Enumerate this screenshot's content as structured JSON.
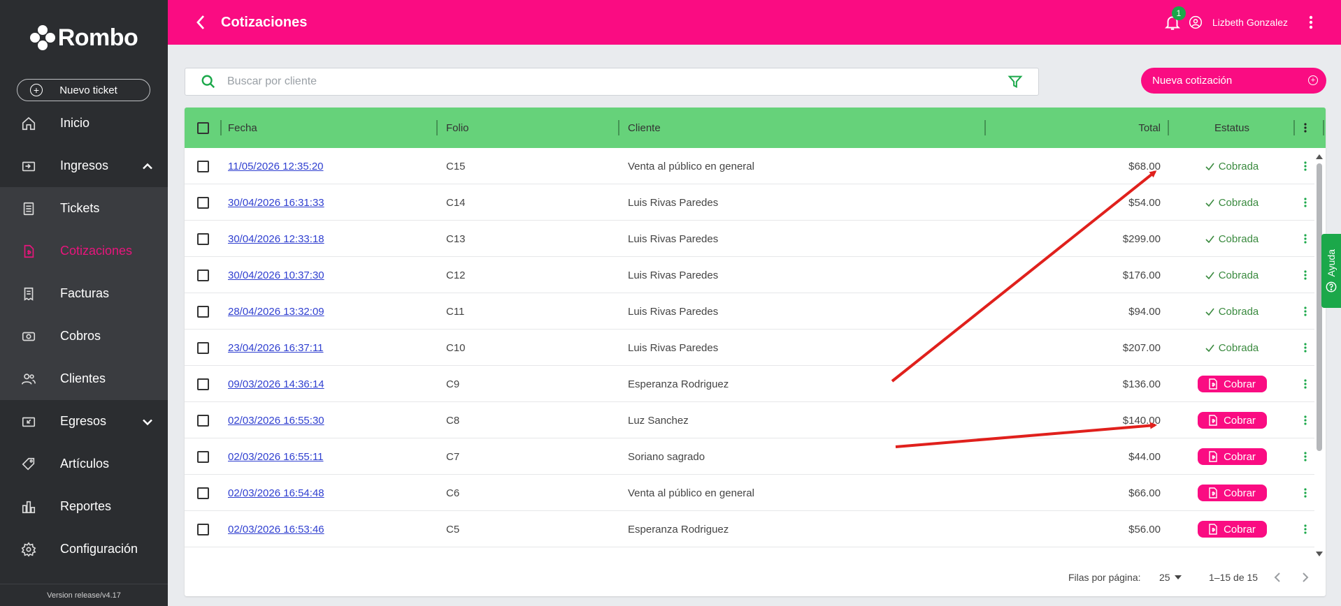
{
  "sidebar": {
    "logo_text": "Rombo",
    "new_ticket_label": "Nuevo ticket",
    "items": [
      {
        "label": "Inicio",
        "icon": "home-icon"
      },
      {
        "label": "Ingresos",
        "icon": "income-icon"
      },
      {
        "label": "Tickets",
        "icon": "receipt-icon"
      },
      {
        "label": "Cotizaciones",
        "icon": "quote-icon"
      },
      {
        "label": "Facturas",
        "icon": "invoice-icon"
      },
      {
        "label": "Cobros",
        "icon": "cash-icon"
      },
      {
        "label": "Clientes",
        "icon": "users-icon"
      },
      {
        "label": "Egresos",
        "icon": "expense-icon"
      },
      {
        "label": "Artículos",
        "icon": "tag-icon"
      },
      {
        "label": "Reportes",
        "icon": "chart-icon"
      },
      {
        "label": "Configuración",
        "icon": "gear-icon"
      }
    ],
    "version": "Version release/v4.17"
  },
  "topbar": {
    "title": "Cotizaciones",
    "notification_count": "1",
    "user_name": "Lizbeth Gonzalez"
  },
  "search": {
    "placeholder": "Buscar por cliente"
  },
  "actions": {
    "new_quote_label": "Nueva cotización"
  },
  "table": {
    "headers": {
      "fecha": "Fecha",
      "folio": "Folio",
      "cliente": "Cliente",
      "total": "Total",
      "estatus": "Estatus"
    },
    "rows": [
      {
        "fecha": "11/05/2026  12:35:20",
        "folio": "C15",
        "cliente": "Venta al público en general",
        "total": "$68.00",
        "estatus": "Cobrada"
      },
      {
        "fecha": "30/04/2026  16:31:33",
        "folio": "C14",
        "cliente": "Luis Rivas Paredes",
        "total": "$54.00",
        "estatus": "Cobrada"
      },
      {
        "fecha": "30/04/2026  12:33:18",
        "folio": "C13",
        "cliente": "Luis Rivas Paredes",
        "total": "$299.00",
        "estatus": "Cobrada"
      },
      {
        "fecha": "30/04/2026  10:37:30",
        "folio": "C12",
        "cliente": "Luis Rivas Paredes",
        "total": "$176.00",
        "estatus": "Cobrada"
      },
      {
        "fecha": "28/04/2026  13:32:09",
        "folio": "C11",
        "cliente": "Luis Rivas Paredes",
        "total": "$94.00",
        "estatus": "Cobrada"
      },
      {
        "fecha": "23/04/2026  16:37:11",
        "folio": "C10",
        "cliente": "Luis Rivas Paredes",
        "total": "$207.00",
        "estatus": "Cobrada"
      },
      {
        "fecha": "09/03/2026  14:36:14",
        "folio": "C9",
        "cliente": "Esperanza Rodriguez",
        "total": "$136.00",
        "estatus": "Cobrar"
      },
      {
        "fecha": "02/03/2026  16:55:30",
        "folio": "C8",
        "cliente": "Luz Sanchez",
        "total": "$140.00",
        "estatus": "Cobrar"
      },
      {
        "fecha": "02/03/2026  16:55:11",
        "folio": "C7",
        "cliente": "Soriano sagrado",
        "total": "$44.00",
        "estatus": "Cobrar"
      },
      {
        "fecha": "02/03/2026  16:54:48",
        "folio": "C6",
        "cliente": "Venta al público en general",
        "total": "$66.00",
        "estatus": "Cobrar"
      },
      {
        "fecha": "02/03/2026  16:53:46",
        "folio": "C5",
        "cliente": "Esperanza Rodriguez",
        "total": "$56.00",
        "estatus": "Cobrar"
      }
    ]
  },
  "pagination": {
    "rows_per_page_label": "Filas por página:",
    "rows_per_page_value": "25",
    "range": "1–15 de 15"
  },
  "help": {
    "label": "Ayuda"
  },
  "colors": {
    "brand_pink": "#fa0c82",
    "header_green": "#66d27a",
    "help_green": "#1ba84a",
    "sidebar_bg": "#2b2d30",
    "annotation_red": "#e0201c"
  }
}
